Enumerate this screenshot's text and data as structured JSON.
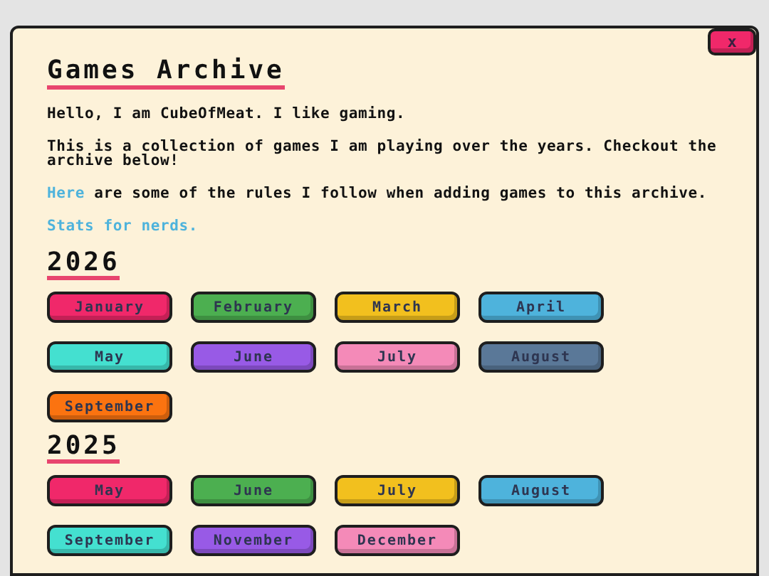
{
  "close_button": "x",
  "title": "Games Archive",
  "intro": "Hello, I am CubeOfMeat. I like gaming.",
  "description": "This is a collection of games I am playing over the years. Checkout the archive below!",
  "rules": {
    "link": "Here",
    "text": " are some of the rules I follow when adding games to this archive."
  },
  "stats_link": "Stats for nerds.",
  "years": [
    {
      "year": "2026",
      "months": [
        {
          "label": "January",
          "color": "#f0286a"
        },
        {
          "label": "February",
          "color": "#4caf50"
        },
        {
          "label": "March",
          "color": "#f2c01e"
        },
        {
          "label": "April",
          "color": "#4eb3dc"
        },
        {
          "label": "May",
          "color": "#44e0d0"
        },
        {
          "label": "June",
          "color": "#985ae6"
        },
        {
          "label": "July",
          "color": "#f48ab8"
        },
        {
          "label": "August",
          "color": "#5a7898"
        },
        {
          "label": "September",
          "color": "#fb7310"
        }
      ]
    },
    {
      "year": "2025",
      "months": [
        {
          "label": "May",
          "color": "#f0286a"
        },
        {
          "label": "June",
          "color": "#4caf50"
        },
        {
          "label": "July",
          "color": "#f2c01e"
        },
        {
          "label": "August",
          "color": "#4eb3dc"
        },
        {
          "label": "September",
          "color": "#44e0d0"
        },
        {
          "label": "November",
          "color": "#985ae6"
        },
        {
          "label": "December",
          "color": "#f48ab8"
        }
      ]
    }
  ]
}
